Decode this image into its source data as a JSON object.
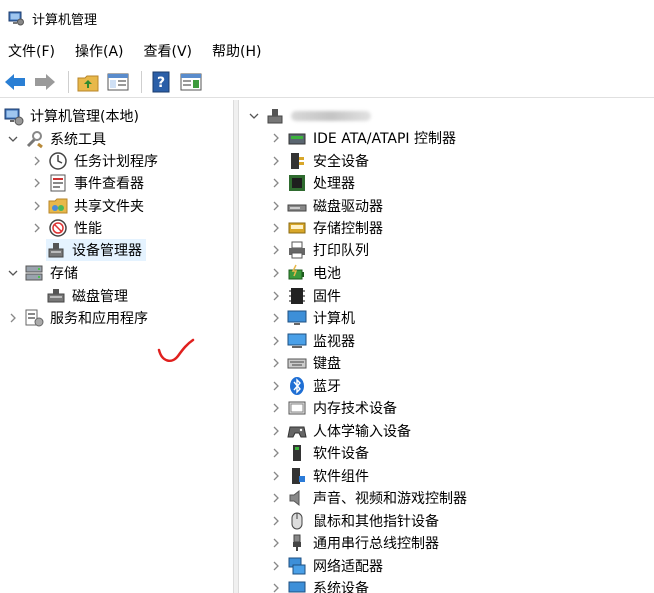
{
  "window": {
    "title": "计算机管理"
  },
  "menu": [
    "文件(F)",
    "操作(A)",
    "查看(V)",
    "帮助(H)"
  ],
  "tree": {
    "root": "计算机管理(本地)",
    "system_tools": "系统工具",
    "task_scheduler": "任务计划程序",
    "event_viewer": "事件查看器",
    "shared_folders": "共享文件夹",
    "performance": "性能",
    "device_manager": "设备管理器",
    "storage": "存储",
    "disk_management": "磁盘管理",
    "services_apps": "服务和应用程序"
  },
  "devices": [
    "IDE ATA/ATAPI 控制器",
    "安全设备",
    "处理器",
    "磁盘驱动器",
    "存储控制器",
    "打印队列",
    "电池",
    "固件",
    "计算机",
    "监视器",
    "键盘",
    "蓝牙",
    "内存技术设备",
    "人体学输入设备",
    "软件设备",
    "软件组件",
    "声音、视频和游戏控制器",
    "鼠标和其他指针设备",
    "通用串行总线控制器",
    "网络适配器",
    "系统设备"
  ],
  "colors": {
    "selection": "#e5f3ff",
    "annotation": "#e0201e",
    "nav_arrow": "#2a7fd4"
  }
}
